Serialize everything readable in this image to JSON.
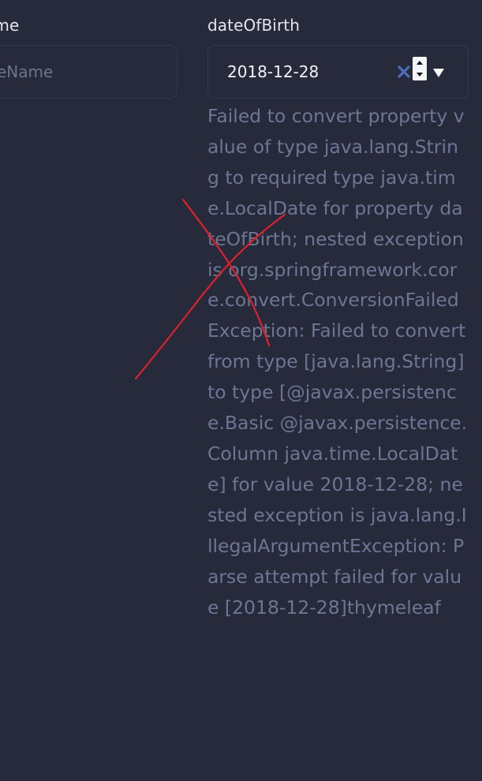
{
  "form": {
    "left_field": {
      "label": "ame",
      "placeholder": "eName"
    },
    "date_field": {
      "label": "dateOfBirth",
      "value": "2018-12-28",
      "error": "Failed to convert property value of type java.lang.String to required type java.time.LocalDate for property dateOfBirth; nested exception is org.springframework.core.convert.ConversionFailedException: Failed to convert from type [java.lang.String] to type [@javax.persistence.Basic @javax.persistence.Column java.time.LocalDate] for value 2018-12-28; nested exception is java.lang.IllegalArgumentException: Parse attempt failed for value [2018-12-28]thymeleaf"
    }
  },
  "icons": {
    "clear": "close-icon",
    "spinner": "stepper-icon",
    "dropdown": "chevron-down-icon",
    "annotation": "red-x-mark"
  },
  "colors": {
    "background": "#262a3b",
    "label": "#e3e5ee",
    "error_text": "#6f7693",
    "annotation": "#e0202c",
    "clear_icon": "#4b6eb8"
  }
}
